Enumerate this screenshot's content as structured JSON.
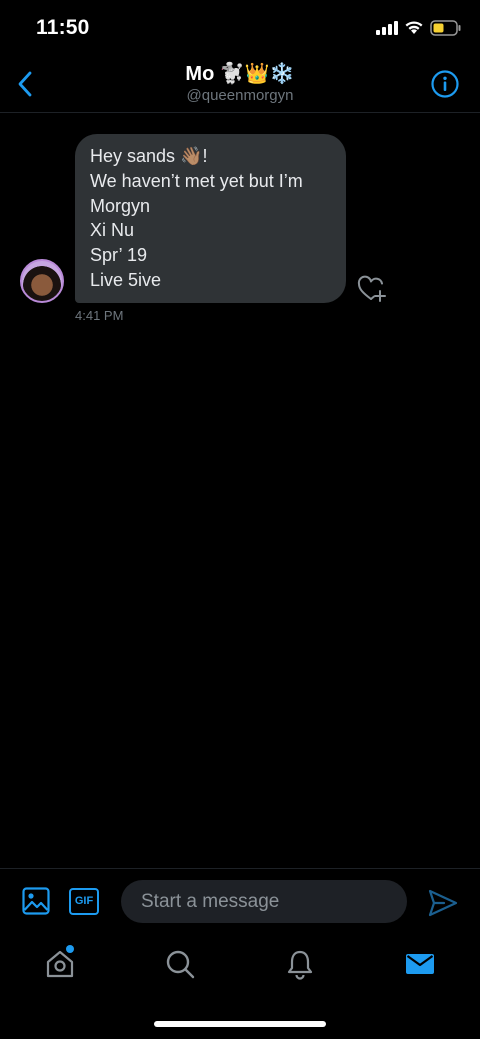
{
  "status_bar": {
    "time": "11:50",
    "icons": [
      "signal-icon",
      "wifi-icon",
      "battery-icon"
    ]
  },
  "header": {
    "title": "Mo 🐩👑❄️",
    "handle": "@queenmorgyn",
    "icons": [
      "chevron-left-icon",
      "info-icon"
    ]
  },
  "conversation": {
    "messages": [
      {
        "lines": [
          "Hey sands 👋🏽!",
          "We haven’t met yet but I’m",
          "Morgyn",
          "Xi Nu",
          "Spr’ 19",
          "Live 5ive"
        ],
        "time": "4:41 PM"
      }
    ]
  },
  "composer": {
    "gif_label": "GIF",
    "placeholder": "Start a message"
  },
  "tab_bar": {
    "tabs": [
      "home-icon",
      "search-icon",
      "bell-icon",
      "mail-icon"
    ],
    "active": "mail-icon",
    "home_unread_dot": true
  },
  "colors": {
    "accent": "#1d9bf0",
    "bubble": "#2f3336",
    "muted_text": "#6e767d",
    "background": "#000000"
  }
}
